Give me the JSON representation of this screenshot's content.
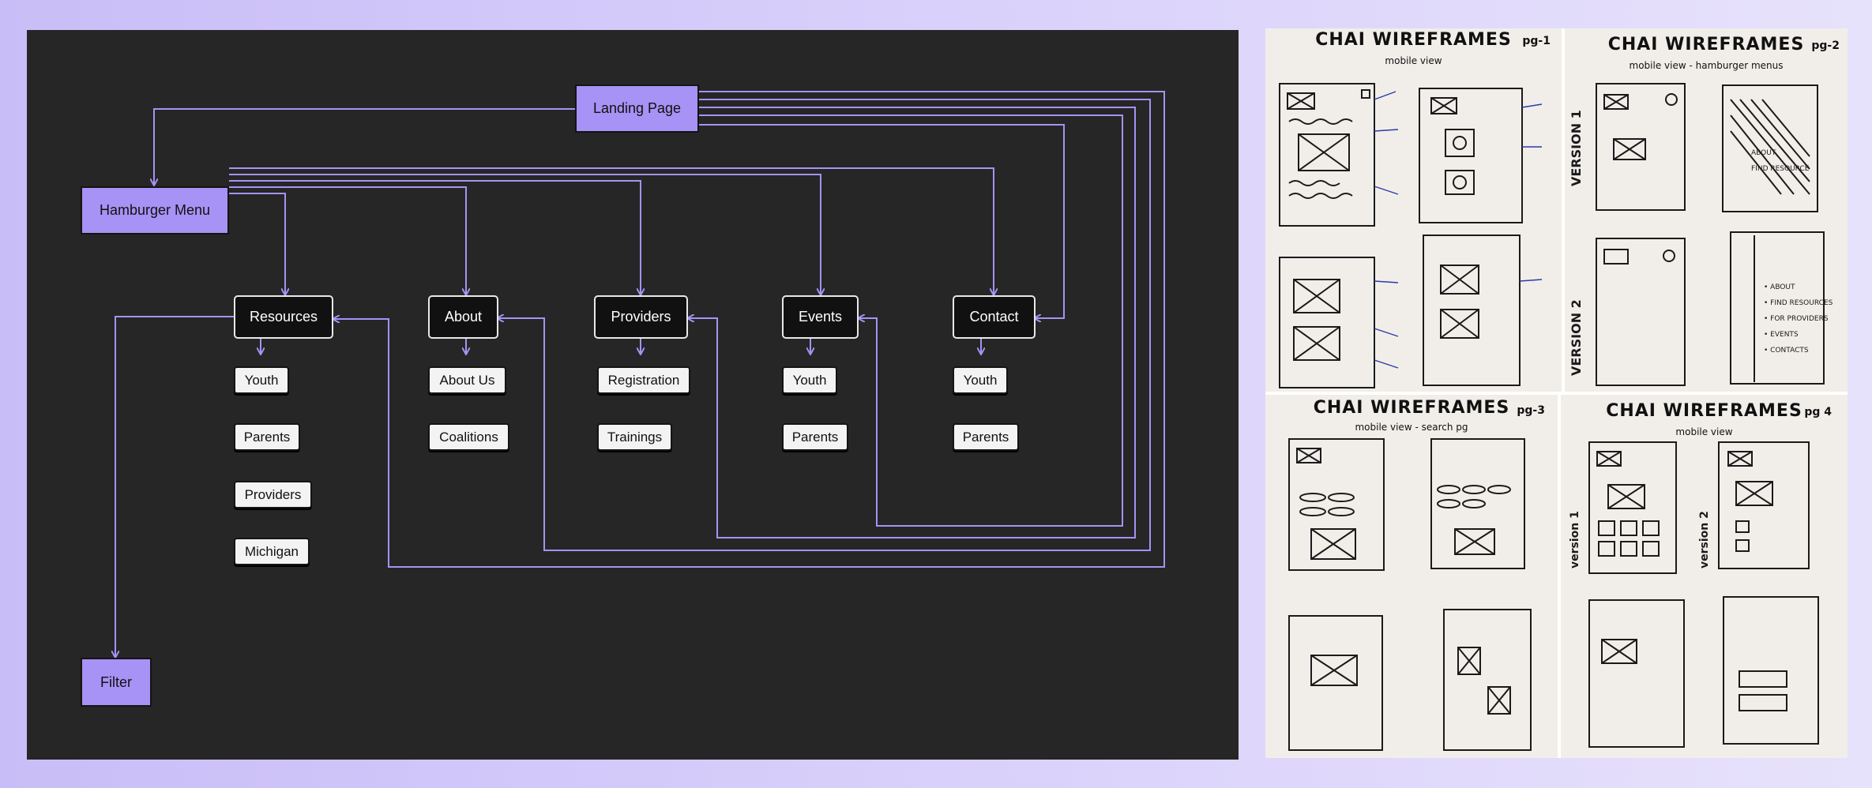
{
  "colors": {
    "background_left": "#c9bdf7",
    "background_right": "#e7e2fb",
    "panel": "#262626",
    "connector": "#a792f5",
    "node_purple": "#a792f5",
    "node_dark": "#111111",
    "node_light": "#f3f3f3"
  },
  "diagram": {
    "landing_page": "Landing Page",
    "hamburger_menu": "Hamburger Menu",
    "filter": "Filter",
    "sections": [
      {
        "label": "Resources",
        "children": [
          "Youth",
          "Parents",
          "Providers",
          "Michigan"
        ]
      },
      {
        "label": "About",
        "children": [
          "About Us",
          "Coalitions"
        ]
      },
      {
        "label": "Providers",
        "children": [
          "Registration",
          "Trainings"
        ]
      },
      {
        "label": "Events",
        "children": [
          "Youth",
          "Parents"
        ]
      },
      {
        "label": "Contact",
        "children": [
          "Youth",
          "Parents"
        ]
      }
    ]
  },
  "wireframe_photos": [
    {
      "title": "CHAI WIREFRAMES",
      "subtitle": "mobile view",
      "page": "pg-1"
    },
    {
      "title": "CHAI WIREFRAMES",
      "subtitle": "mobile view - hamburger menus",
      "page": "pg-2"
    },
    {
      "title": "CHAI WIREFRAMES",
      "subtitle": "mobile view - search pg",
      "page": "pg-3"
    },
    {
      "title": "CHAI WIREFRAMES",
      "subtitle": "mobile view",
      "page": "pg 4"
    }
  ]
}
